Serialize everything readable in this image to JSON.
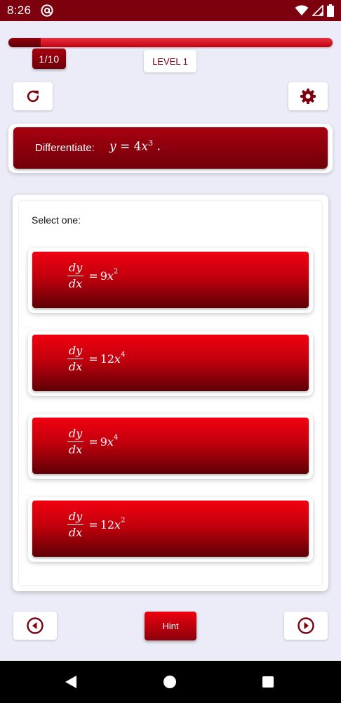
{
  "status_bar": {
    "time": "8:26",
    "app_icon": "at-sign-icon",
    "icons": [
      "wifi-icon",
      "cell-signal-icon",
      "battery-icon"
    ]
  },
  "progress": {
    "fraction": 0.1,
    "counter": "1/10"
  },
  "level": {
    "label": "LEVEL 1"
  },
  "toolbar": {
    "refresh_icon": "refresh-icon",
    "settings_icon": "gear-icon"
  },
  "question": {
    "label": "Differentiate:",
    "lhs": "y",
    "equals": "=",
    "coefficient": "4",
    "variable": "x",
    "exponent": "3",
    "terminator": "."
  },
  "answers": {
    "prompt": "Select one:",
    "options": [
      {
        "num": "dy",
        "den": "dx",
        "equals": "=",
        "coefficient": "9",
        "variable": "x",
        "exponent": "2"
      },
      {
        "num": "dy",
        "den": "dx",
        "equals": "=",
        "coefficient": "12",
        "variable": "x",
        "exponent": "4"
      },
      {
        "num": "dy",
        "den": "dx",
        "equals": "=",
        "coefficient": "9",
        "variable": "x",
        "exponent": "4"
      },
      {
        "num": "dy",
        "den": "dx",
        "equals": "=",
        "coefficient": "12",
        "variable": "x",
        "exponent": "2"
      }
    ]
  },
  "footer": {
    "hint_label": "Hint",
    "prev_icon": "circle-arrow-left-icon",
    "next_icon": "circle-arrow-right-icon"
  },
  "colors": {
    "brand_dark": "#7d000e",
    "brand_red": "#e8000f",
    "background": "#ececf8"
  }
}
